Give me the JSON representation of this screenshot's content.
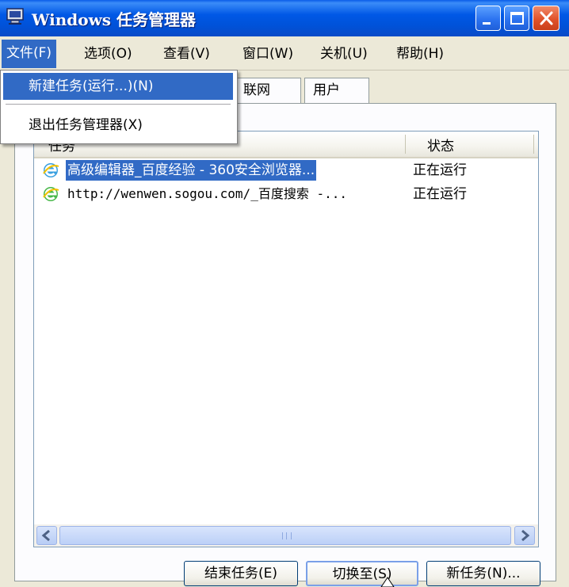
{
  "window": {
    "title": "Windows 任务管理器",
    "colors": {
      "titlebar": "#0054e3",
      "selection": "#316ac5",
      "face": "#ece9d8",
      "close": "#e0522a"
    }
  },
  "menu": {
    "items": [
      "文件(F)",
      "选项(O)",
      "查看(V)",
      "窗口(W)",
      "关机(U)",
      "帮助(H)"
    ],
    "active_index": 0
  },
  "file_menu": {
    "items": [
      "新建任务(运行...)(N)",
      "退出任务管理器(X)"
    ],
    "highlighted_index": 0
  },
  "tabs": [
    "联网",
    "用户"
  ],
  "task_list": {
    "columns": [
      "任务",
      "状态"
    ],
    "rows": [
      {
        "name": "高级编辑器_百度经验 - 360安全浏览器...",
        "status": "正在运行",
        "selected": true,
        "icon": "ie-browser-icon"
      },
      {
        "name": "http://wenwen.sogou.com/_百度搜索 -...",
        "status": "正在运行",
        "selected": false,
        "icon": "ie-browser-icon"
      }
    ]
  },
  "buttons": {
    "end_task": "结束任务(E)",
    "switch_to": "切换至(S)",
    "new_task": "新任务(N)..."
  }
}
